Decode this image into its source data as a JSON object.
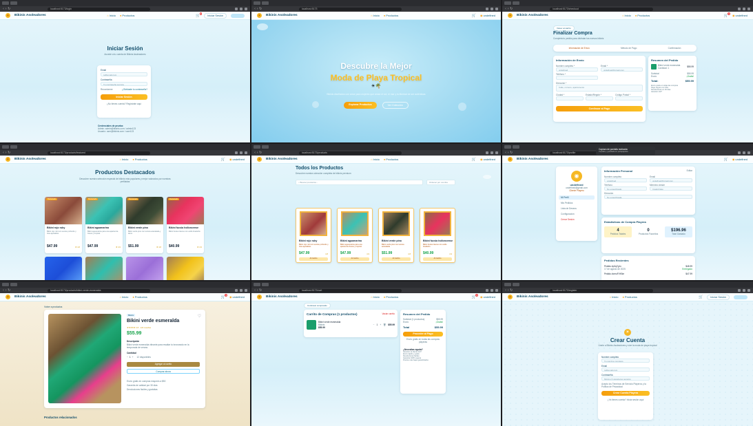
{
  "brand": "Bikinis Asoleadores",
  "nav": {
    "home": "Inicio",
    "products": "Productos",
    "login": "Iniciar Sesión",
    "user": "undefined"
  },
  "cart_count": "1",
  "panels": {
    "login": {
      "url": "localhost:5173/login",
      "title": "Iniciar Sesión",
      "subtitle": "Accede a tu cuenta de Bikinis Asoleadores",
      "email_label": "Email",
      "email_placeholder": "tu@email.com",
      "password_label": "Contraseña",
      "password_placeholder": "Tu contraseña secreta",
      "remember": "Recordarme",
      "forgot": "¿Olvidaste tu contraseña?",
      "submit": "Iniciar Sesión",
      "no_account": "¿No tienes cuenta? Regístrate aquí",
      "demo_title": "Credenciales de prueba:",
      "demo_admin": "Admin: admin@bikinis.com / admin123",
      "demo_user": "Usuario: user@bikinis.com / user123"
    },
    "hero": {
      "url": "localhost:5173",
      "title_line1": "Descubre la Mejor",
      "title_line2": "Moda de Playa Tropical",
      "subtitle": "Bikinis diseñados con amor para mujeres que aman el sol, el mar y la libertad de ser auténticas",
      "cta_primary": "Explorar Productos",
      "cta_secondary": "Ver Colección"
    },
    "checkout": {
      "url": "localhost:5173/checkout",
      "back": "Volver al carrito",
      "title": "Finalizar Compra",
      "subtitle": "Completa tu pedido para disfrutar tus nuevos bikinis",
      "steps": [
        "Información de Envío",
        "Método de Pago",
        "Confirmación"
      ],
      "section": "Información de Envío",
      "fields": [
        "Nombre completo *",
        "Email *",
        "Teléfono *",
        "Dirección *",
        "Ciudad *",
        "Estado/Región *",
        "Código Postal *"
      ],
      "values": {
        "name": "undefined",
        "email": "undefined@gmail.com",
        "address": "Calle, número, apartamento"
      },
      "submit": "Continuar al Pago",
      "summary_title": "Resumen del Pedido",
      "item_name": "Bikini verde esmeralda",
      "item_qty": "Cantidad: 1",
      "item_price": "$55.99",
      "subtotal_label": "Subtotal",
      "subtotal": "$55.99",
      "shipping_label": "Envío",
      "shipping": "¡Gratis!",
      "total_label": "Total:",
      "total": "$55.99",
      "notes": [
        "Envío gratis en todas las compras",
        "Pago seguro con SSL",
        "Devoluciones en 30 días",
        "Atención 24/7"
      ]
    },
    "featured": {
      "url": "localhost:5173/products/featured",
      "title": "Productos Destacados",
      "subtitle": "Descubre nuestra selección especial de bikinis más populares y mejor valorados por nuestras perfiladas",
      "products": [
        {
          "tag": "Destacado",
          "name": "Bikini rojo ruby",
          "desc": "Bikini rojo rubí con escote profundo y tiras ajustables",
          "price": "$47.99",
          "rating": "★ 4.8"
        },
        {
          "tag": "Destacado",
          "name": "Bikini aguamarina",
          "desc": "Bikini aguamarina para una apariencia fresca y tropical",
          "price": "$47.99",
          "rating": "★ 4.9"
        },
        {
          "tag": "Destacado",
          "name": "Bikini verde pino",
          "desc": "Bikini verde pino con textura acanalada y lazos",
          "price": "$51.99",
          "rating": "★ 4.8"
        },
        {
          "tag": "Destacado",
          "name": "Bikini fucsia holloncense",
          "desc": "Bikini fucsia intenso con estilo brasileño",
          "price": "$40.99",
          "rating": "★ 4.9"
        }
      ]
    },
    "all_products": {
      "url": "localhost:5173/products",
      "title": "Todos los Productos",
      "subtitle": "Descubre nuestra colección completa de bikinis premium",
      "search_placeholder": "Buscar productos...",
      "sort": "Ordenar por nombre",
      "products": [
        {
          "name": "Bikini rojo ruby",
          "desc": "Bikini rojo rubí con escote profundo y tiras ajustables",
          "price": "$47.99",
          "rating": "4.8",
          "add": "Al Carrito"
        },
        {
          "name": "Bikini aguamarina",
          "desc": "Bikini aguamarina para una apariencia fresca y tropical",
          "price": "$47.99",
          "rating": "4.9",
          "add": "Al Carrito"
        },
        {
          "name": "Bikini verde pino",
          "desc": "Bikini verde pino con textura acanalada",
          "price": "$51.99",
          "rating": "4.8",
          "add": "Al Carrito"
        },
        {
          "name": "Bikini fucsia holloncense",
          "desc": "Bikini fucsia intenso con estilo brasileño",
          "price": "$40.99",
          "rating": "4.9",
          "add": "Al Carrito"
        }
      ]
    },
    "profile": {
      "url": "localhost:5173/profile",
      "toast_title": "Captura de pantalla realizada",
      "toast_sub": "Copiada y guardada en portapapeles",
      "username": "undefined",
      "email": "undefined@gmail.com",
      "badge": "Cliente Playero",
      "menu": [
        "Mi Perfil",
        "Mis Pedidos",
        "Lista de Deseos",
        "Configuración",
        "Cerrar Sesión"
      ],
      "info_title": "Información Personal",
      "edit": "Editar",
      "labels": [
        "Nombre completo",
        "Email",
        "Teléfono",
        "Miembro desde",
        "Dirección"
      ],
      "values": [
        "undefined",
        "undefined@gmail.com",
        "No especificado",
        "Invalid Date",
        "No especificada"
      ],
      "stats_title": "Estadísticas de Compra Playera",
      "stats": [
        {
          "value": "4",
          "label": "Pedidos Totales"
        },
        {
          "value": "0",
          "label": "Productos Favoritos"
        },
        {
          "value": "$196.96",
          "label": "Total Gastado"
        }
      ],
      "orders_title": "Pedidos Recientes",
      "orders": [
        {
          "id": "Pedido #p2q7g1x",
          "date": "17 de agosto de 2025",
          "price": "$48.99",
          "status": "Entregado"
        },
        {
          "id": "Pedido #ceruFVKNe",
          "price": "$47.99"
        }
      ]
    },
    "detail": {
      "url": "localhost:5173/products/bikini-verde-esmeralda",
      "back": "Volver a productos",
      "category": "Bikinis",
      "title": "Bikini verde esmeralda",
      "rating": "★★★★★ 4.8 · 124 reseñas",
      "price": "$55.99",
      "desc_label": "Descripción",
      "desc": "Bikini verde esmeralda vibrante para resaltar tu bronceado en la temporada de verano.",
      "qty_label": "Cantidad",
      "qty": "1",
      "stock": "12 disponibles",
      "add": "Agregar al carrito",
      "buy": "Comprar ahora",
      "perks": [
        "Envío gratis en compras mayores a $50",
        "Garantía de calidad por 30 días",
        "Devoluciones fáciles y gratuitas"
      ],
      "related": "Productos relacionados"
    },
    "cart": {
      "url": "localhost:5173/cart",
      "back": "Continuar comprando",
      "title": "Carrito de Compras (1 productos)",
      "clear": "Vaciar carrito",
      "item_name": "Bikini verde esmeralda",
      "item_cat": "Bikinis",
      "item_price": "$55.99",
      "qty": "1",
      "line_total": "$55.99",
      "summary_title": "Resumen del Pedido",
      "rows": [
        {
          "label": "Subtotal (1 productos)",
          "value": "$55.99"
        },
        {
          "label": "Envío",
          "value": "¡Gratis!"
        }
      ],
      "total_label": "Total",
      "total": "$55.99",
      "checkout": "Proceder al Pago",
      "free_ship": "Envío gratis en todas las compras playeras",
      "help_title": "¿Necesitas ayuda?",
      "help": [
        "Atención al cliente 24/7",
        "Envío rápido y gratis",
        "Devoluciones fáciles",
        "Garantía 100% segura",
        "Precios más bajos garantizados"
      ]
    },
    "register": {
      "url": "localhost:5173/register",
      "title": "Crear Cuenta",
      "subtitle": "Únete a Bikinis Asoleadores y vive la moda de playa tropical",
      "name_label": "Nombre completo",
      "name_placeholder": "Tu nombre completo",
      "email_label": "Email",
      "email_placeholder": "tu@email.com",
      "password_label": "Contraseña",
      "password_placeholder": "Mínimo 6 caracteres seguros",
      "terms": "Acepto los Términos de Servicio Playeros y la Política de Privacidad",
      "submit": "Crear Cuenta Playera",
      "have_account": "¿Ya tienes cuenta? Inicia sesión aquí"
    }
  },
  "colors": {
    "gold": "#f59e0b",
    "navy": "#134e6b",
    "sky": "#bfe6f8"
  }
}
